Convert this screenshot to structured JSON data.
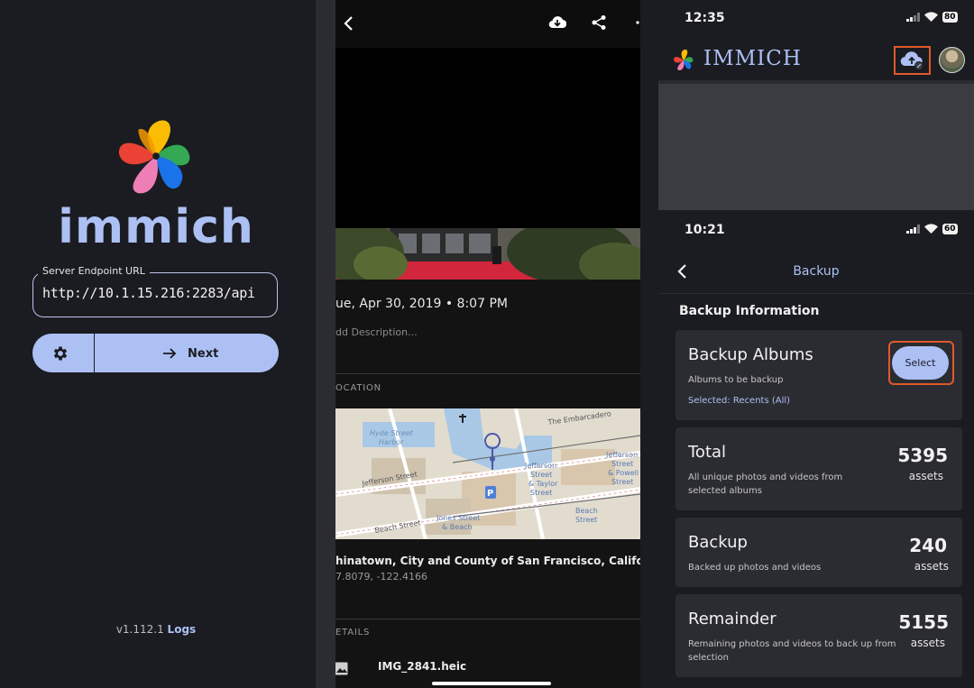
{
  "login": {
    "app_name": "immich",
    "server_label": "Server Endpoint URL",
    "server_url": "http://10.1.15.216:2283/api",
    "next_label": "Next",
    "version": "v1.112.1",
    "logs_label": "Logs"
  },
  "photo": {
    "date": "ue, Apr 30, 2019 • 8:07 PM",
    "description_placeholder": "dd Description...",
    "location_heading": "OCATION",
    "place": "hinatown, City and County of San Francisco, California",
    "coords": "7.8079, -122.4166",
    "details_heading": "ETAILS",
    "filename": "IMG_2841.heic",
    "map_labels": [
      "Hyde Street",
      "Harbor",
      "The Embarcadero",
      "Jefferson Street",
      "Jefferson",
      "Street",
      "& Taylor",
      "Street",
      "Jefferson",
      "Street",
      "& Powell",
      "Street",
      "Jones Street",
      "& Beach",
      "Beach",
      "Street",
      "Beach Street"
    ]
  },
  "home": {
    "time": "12:35",
    "battery": "80",
    "title": "IMMICH"
  },
  "backup": {
    "time": "10:21",
    "battery": "60",
    "title": "Backup",
    "section": "Backup Information",
    "albums_title": "Backup Albums",
    "albums_sub": "Albums to be backup",
    "albums_selected": "Selected: Recents (All)",
    "select_label": "Select",
    "total_title": "Total",
    "total_sub": "All unique photos and videos from selected albums",
    "total_value": "5395",
    "total_unit": "assets",
    "backup_title": "Backup",
    "backup_sub": "Backed up photos and videos",
    "backup_value": "240",
    "backup_unit": "assets",
    "remainder_title": "Remainder",
    "remainder_sub": "Remaining photos and videos to back up from selection",
    "remainder_value": "5155",
    "remainder_unit": "assets"
  },
  "colors": {
    "accent": "#acc0f4",
    "background": "#1b1c21",
    "card": "#2b2c31",
    "highlight": "#e05a2b"
  }
}
